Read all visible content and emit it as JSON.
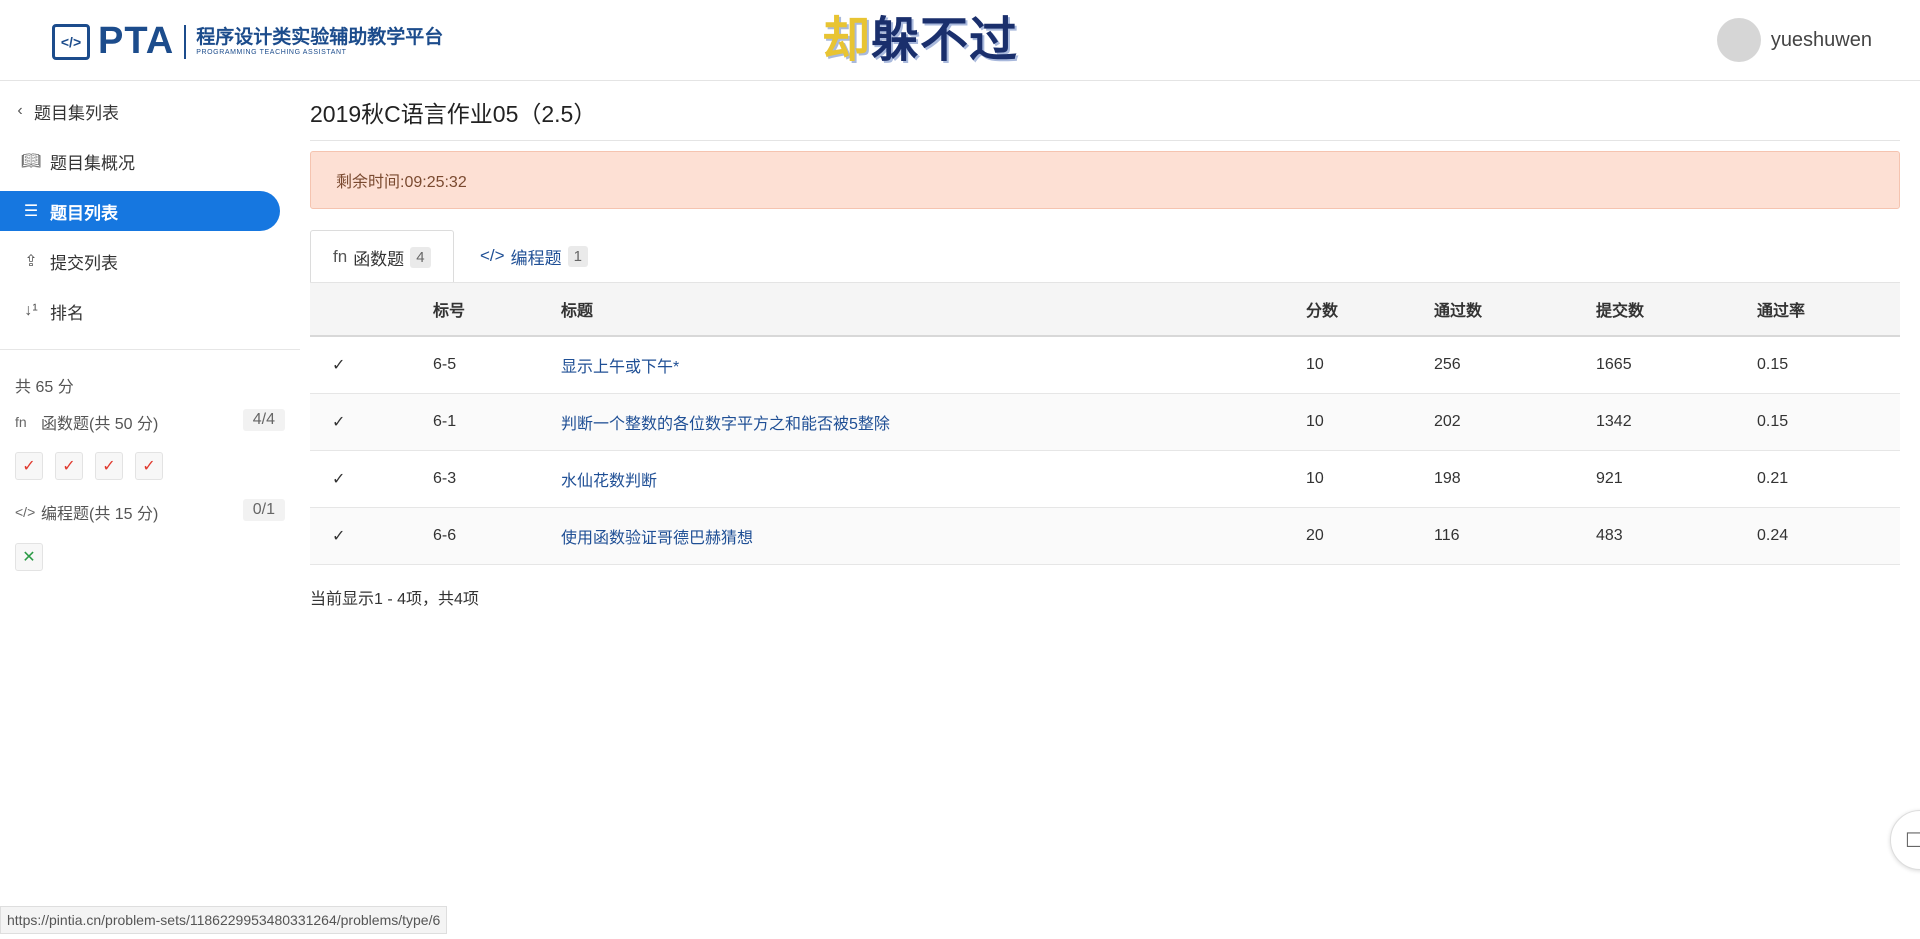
{
  "header": {
    "logo_mark": "</>",
    "logo_name": "PTA",
    "logo_cn": "程序设计类实验辅助教学平台",
    "logo_en": "PROGRAMMING TEACHING ASSISTANT",
    "banner_first": "却",
    "banner_rest": "躲不过",
    "username": "yueshuwen"
  },
  "sidebar": {
    "back_label": "题目集列表",
    "items": [
      {
        "label": "题目集概况",
        "icon": "book-icon"
      },
      {
        "label": "题目列表",
        "icon": "list-icon",
        "active": true
      },
      {
        "label": "提交列表",
        "icon": "upload-icon"
      },
      {
        "label": "排名",
        "icon": "sort-numeric-icon"
      }
    ],
    "total_score": "共 65 分",
    "groups": [
      {
        "icon": "function-icon",
        "label": "函数题(共 50 分)",
        "count": "4/4",
        "marks": [
          "✓",
          "✓",
          "✓",
          "✓"
        ]
      },
      {
        "icon": "code-icon",
        "label": "编程题(共 15 分)",
        "count": "0/1",
        "marks": [
          "✕"
        ]
      }
    ]
  },
  "main": {
    "title": "2019秋C语言作业05（2.5）",
    "timer": "剩余时间:09:25:32",
    "tabs": [
      {
        "icon": "fn",
        "label": "函数题",
        "badge": "4"
      },
      {
        "icon": "</>",
        "label": "编程题",
        "badge": "1"
      }
    ],
    "columns": [
      "标号",
      "标题",
      "分数",
      "通过数",
      "提交数",
      "通过率"
    ],
    "rows": [
      {
        "status": "✓",
        "id": "6-5",
        "title": "显示上午或下午*",
        "score": "10",
        "passed": "256",
        "submitted": "1665",
        "rate": "0.15"
      },
      {
        "status": "✓",
        "id": "6-1",
        "title": "判断一个整数的各位数字平方之和能否被5整除",
        "score": "10",
        "passed": "202",
        "submitted": "1342",
        "rate": "0.15"
      },
      {
        "status": "✓",
        "id": "6-3",
        "title": "水仙花数判断",
        "score": "10",
        "passed": "198",
        "submitted": "921",
        "rate": "0.21"
      },
      {
        "status": "✓",
        "id": "6-6",
        "title": "使用函数验证哥德巴赫猜想",
        "score": "20",
        "passed": "116",
        "submitted": "483",
        "rate": "0.24"
      }
    ],
    "paging": "当前显示1 - 4项，共4项"
  },
  "statusbar": {
    "url": "https://pintia.cn/problem-sets/1186229953480331264/problems/type/6"
  },
  "colors": {
    "primary": "#1677e0",
    "brand": "#1c4c8c",
    "timer_bg": "#fde0d4",
    "check": "#e0392e",
    "cross": "#2a9a45",
    "link": "#1f4f95"
  }
}
